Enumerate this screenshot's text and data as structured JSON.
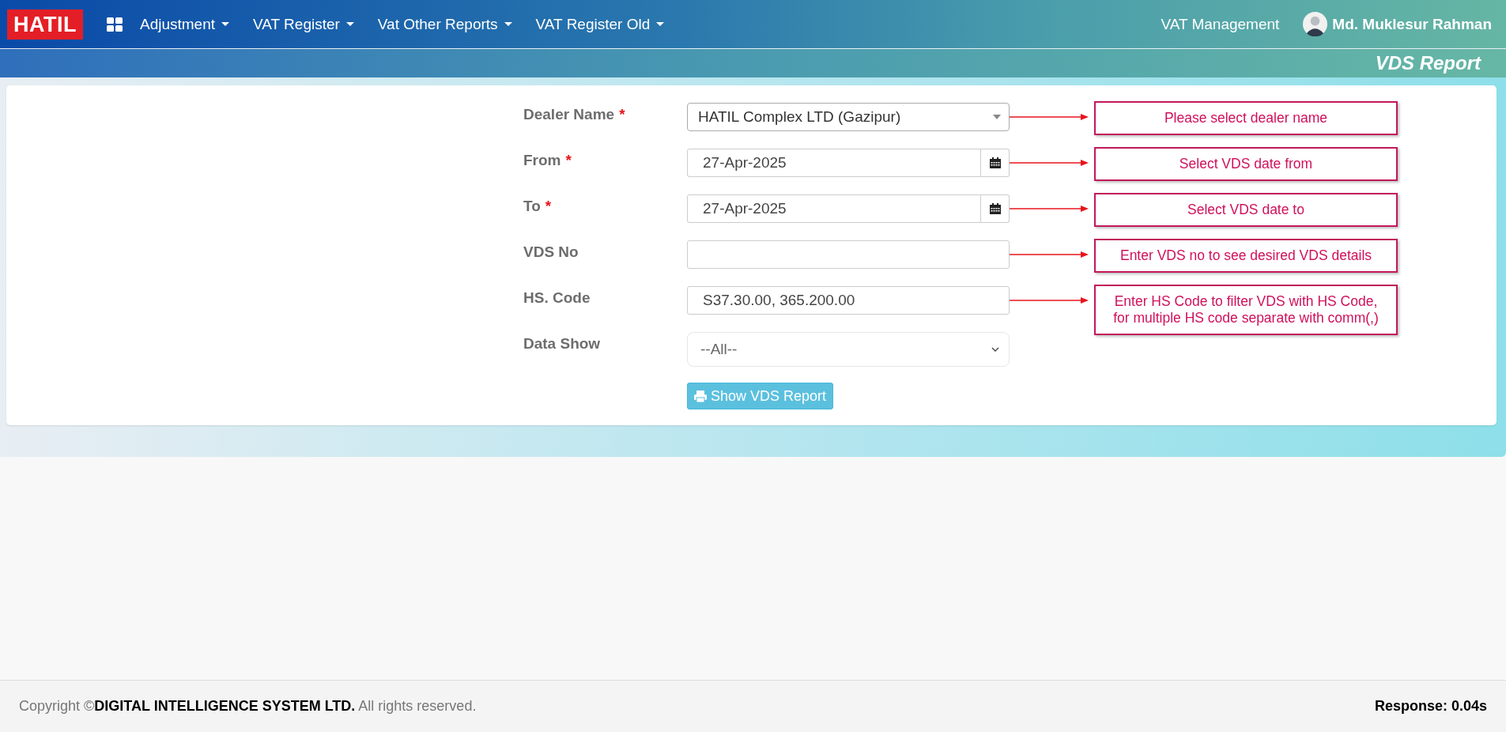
{
  "navbar": {
    "brand": "HATIL",
    "menus": [
      {
        "label": "Adjustment"
      },
      {
        "label": "VAT Register"
      },
      {
        "label": "Vat Other Reports"
      },
      {
        "label": "VAT Register Old"
      }
    ],
    "module": "VAT Management",
    "user": "Md. Muklesur Rahman"
  },
  "page_title": "VDS Report",
  "form": {
    "fields": [
      {
        "label": "Dealer Name",
        "required_mark": "*",
        "kind": "select",
        "value": "HATIL Complex LTD (Gazipur)",
        "callout": "Please select dealer name"
      },
      {
        "label": "From",
        "required_mark": "*",
        "kind": "date",
        "value": "27-Apr-2025",
        "callout": "Select VDS date from"
      },
      {
        "label": "To",
        "required_mark": "*",
        "kind": "date",
        "value": "27-Apr-2025",
        "callout": "Select VDS date to"
      },
      {
        "label": "VDS No",
        "kind": "text",
        "callout": "Enter VDS no to see desired VDS details"
      },
      {
        "label": "HS. Code",
        "kind": "text",
        "value": "S37.30.00, 365.200.00",
        "callout": "Enter HS Code to filter VDS with HS Code, for multiple HS code separate with comm(,)"
      },
      {
        "label": "Data Show",
        "kind": "native-select",
        "value": "--All--"
      }
    ],
    "button": "Show VDS Report"
  },
  "footer": {
    "copyright": "Copyright ©**DIGITAL INTELLIGENCE SYSTEM LTD.** All rights reserved.",
    "response": "Response: 0.04s"
  }
}
